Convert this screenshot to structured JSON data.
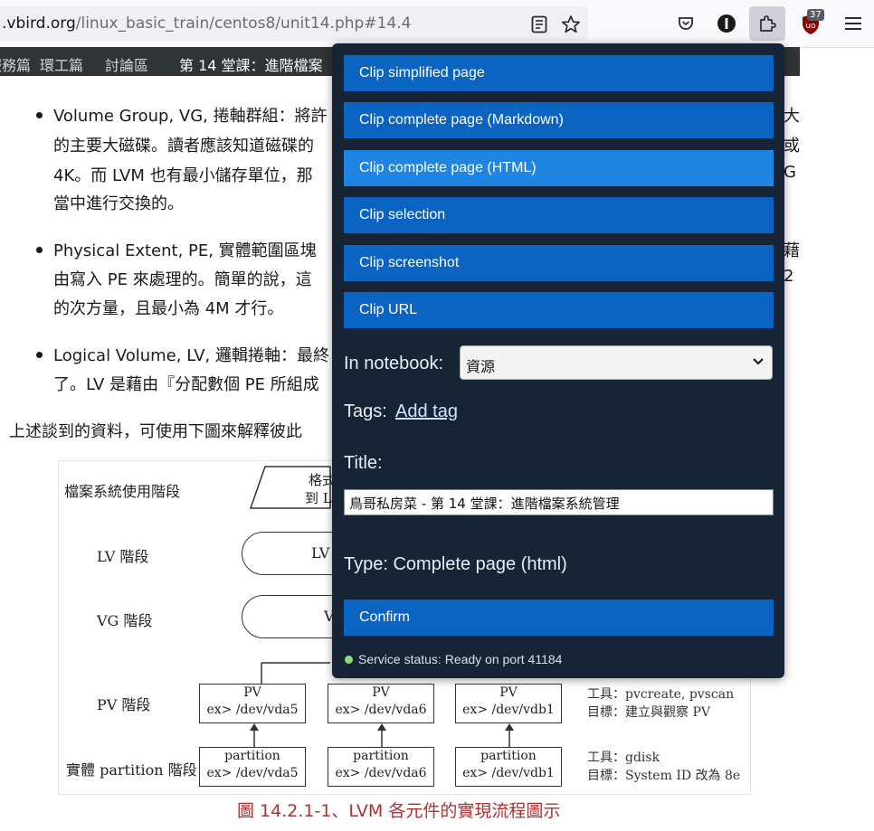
{
  "browser": {
    "url_host": ".vbird.org",
    "url_path": "/linux_basic_train/centos8/unit14.php#14.4",
    "extensions_badge": "37"
  },
  "site_nav": {
    "items": [
      "服務篇",
      "環工篇",
      "討論區"
    ],
    "current": "第 14 堂課：進階檔案"
  },
  "article": {
    "bullets": [
      {
        "lines": [
          "Volume Group, VG, 捲軸群組：將許",
          "的主要大磁碟。讀者應該知道磁碟的",
          "4K。而 LVM 也有最小儲存單位，那",
          "當中進行交換的。"
        ]
      },
      {
        "lines": [
          "Physical Extent, PE, 實體範圍區塊",
          "由寫入 PE 來處理的。簡單的說，這",
          "的次方量，且最小為 4M 才行。"
        ]
      },
      {
        "lines": [
          "Logical Volume, LV, 邏輯捲軸：最終",
          "了。LV 是藉由『分配數個 PE 所組成"
        ]
      }
    ],
    "right_edge_chars": [
      "大",
      "或",
      "G",
      "藉",
      "2"
    ],
    "paragraph": "上述談到的資料，可使用下圖來解釋彼此"
  },
  "figure": {
    "stage_labels": {
      "fs": "檔案系統使用階段",
      "lv": "LV 階段",
      "vg": "VG 階段",
      "pv": "PV 階段",
      "partition": "實體 partition 階段"
    },
    "fs_box_text": [
      "格式",
      "到 L"
    ],
    "lv_pill": "LV",
    "vg_pill": "V",
    "pv_boxes": [
      {
        "title": "PV",
        "dev": "ex> /dev/vda5"
      },
      {
        "title": "PV",
        "dev": "ex> /dev/vda6"
      },
      {
        "title": "PV",
        "dev": "ex> /dev/vdb1"
      }
    ],
    "partition_boxes": [
      {
        "title": "partition",
        "dev": "ex> /dev/vda5"
      },
      {
        "title": "partition",
        "dev": "ex> /dev/vda6"
      },
      {
        "title": "partition",
        "dev": "ex> /dev/vdb1"
      }
    ],
    "pv_tool": [
      "工具：pvcreate, pvscan",
      "目標：建立與觀察 PV"
    ],
    "partition_tool": [
      "工具：gdisk",
      "目標：System ID 改為 8e"
    ],
    "caption": "圖 14.2.1-1、LVM 各元件的實現流程圖示"
  },
  "popup": {
    "buttons": [
      "Clip simplified page",
      "Clip complete page (Markdown)",
      "Clip complete page (HTML)",
      "Clip selection",
      "Clip screenshot",
      "Clip URL"
    ],
    "notebook_label": "In notebook:",
    "notebook_value": "資源",
    "tags_label": "Tags:",
    "add_tag": "Add tag",
    "title_label": "Title:",
    "title_value": "鳥哥私房菜 - 第 14 堂課：進階檔案系統管理",
    "type_text": "Type: Complete page (html)",
    "confirm": "Confirm",
    "status": "Service status: Ready on port 41184",
    "colors": {
      "panel": "#172435",
      "button": "#0b63c2",
      "button_hover": "#1e86e2",
      "status_ok": "#7fe27f"
    }
  }
}
